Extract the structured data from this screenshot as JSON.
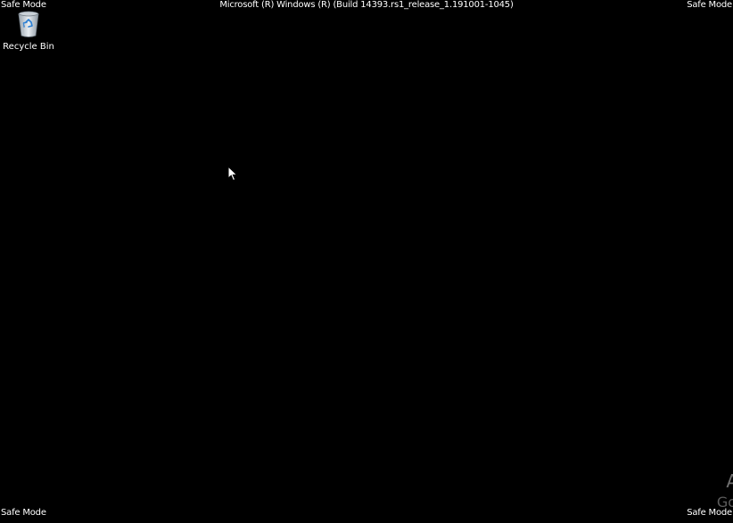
{
  "desktop": {
    "background_color": "#000000",
    "mode_label": "Safe Mode",
    "build_string": "Microsoft (R) Windows (R) (Build 14393.rs1_release_1.191001-1045)",
    "icons": [
      {
        "label": "Recycle Bin",
        "icon": "recycle-bin-icon"
      }
    ],
    "activation_watermark": {
      "line1": "A",
      "line2": "Go"
    },
    "cursor": "mouse-pointer-icon"
  }
}
